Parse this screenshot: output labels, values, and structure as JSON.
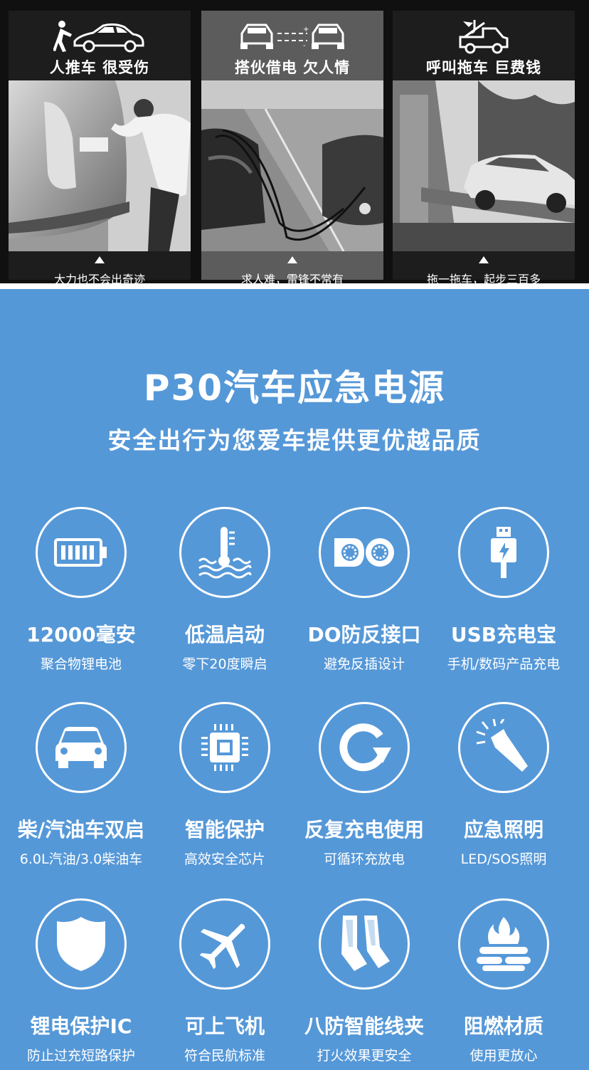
{
  "panels": [
    {
      "title": "人推车 很受伤",
      "caption": "大力也不会出奇迹",
      "icon": "pushing-car-icon"
    },
    {
      "title": "搭伙借电 欠人情",
      "caption": "求人难，雷锋不常有",
      "icon": "jump-cable-cars-icon"
    },
    {
      "title": "呼叫拖车 巨费钱",
      "caption": "拖一拖车，起步三百多",
      "icon": "tow-truck-icon"
    }
  ],
  "headline": {
    "title": "P30汽车应急电源",
    "subtitle": "安全出行为您爱车提供更优越品质"
  },
  "features": [
    {
      "title": "12000毫安",
      "sub": "聚合物锂电池",
      "icon": "battery-icon"
    },
    {
      "title": "低温启动",
      "sub": "零下20度瞬启",
      "icon": "thermometer-icon"
    },
    {
      "title": "DO防反接口",
      "sub": "避免反插设计",
      "icon": "do-port-icon"
    },
    {
      "title": "USB充电宝",
      "sub": "手机/数码产品充电",
      "icon": "usb-plug-icon"
    },
    {
      "title": "柴/汽油车双启",
      "sub": "6.0L汽油/3.0柴油车",
      "icon": "car-icon"
    },
    {
      "title": "智能保护",
      "sub": "高效安全芯片",
      "icon": "chip-icon"
    },
    {
      "title": "反复充电使用",
      "sub": "可循环充放电",
      "icon": "recycle-arrow-icon"
    },
    {
      "title": "应急照明",
      "sub": "LED/SOS照明",
      "icon": "flashlight-icon"
    },
    {
      "title": "锂电保护IC",
      "sub": "防止过充短路保护",
      "icon": "shield-icon"
    },
    {
      "title": "可上飞机",
      "sub": "符合民航标准",
      "icon": "airplane-icon"
    },
    {
      "title": "八防智能线夹",
      "sub": "打火效果更安全",
      "icon": "clamp-icon"
    },
    {
      "title": "阻燃材质",
      "sub": "使用更放心",
      "icon": "flame-retardant-icon"
    }
  ],
  "colors": {
    "background_blue": "#5598d8",
    "dark_band": "#101010",
    "highlight_panel": "#5c5c5c",
    "foreground": "#ffffff"
  }
}
